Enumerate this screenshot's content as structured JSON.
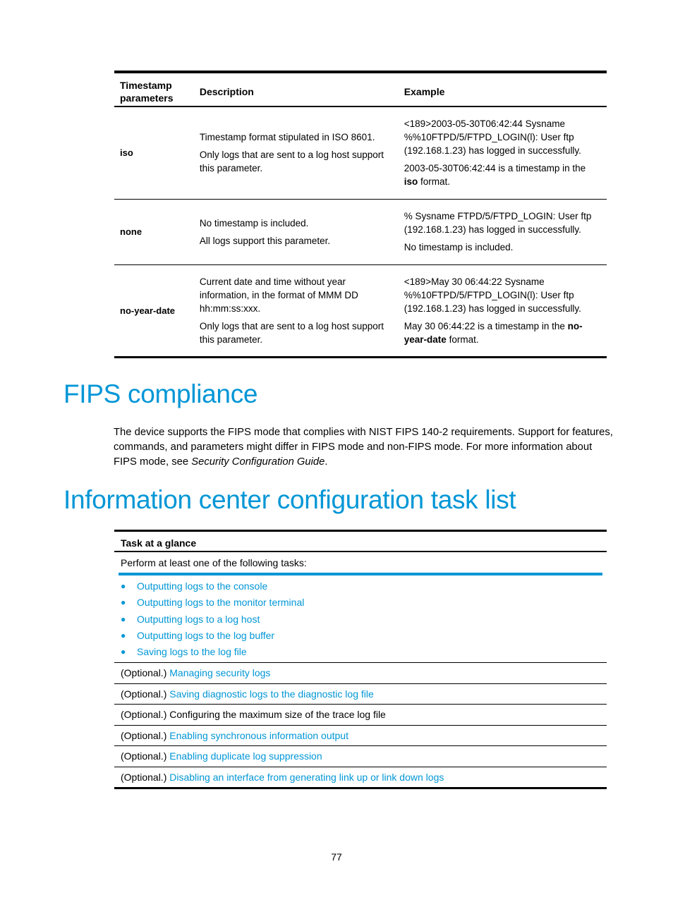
{
  "timestamp_table": {
    "headers": [
      "Timestamp parameters",
      "Description",
      "Example"
    ],
    "rows": [
      {
        "param": "iso",
        "description": [
          "Timestamp format stipulated in ISO 8601.",
          "Only logs that are sent to a log host support this parameter."
        ],
        "example_log": "<189>2003-05-30T06:42:44 Sysname %%10FTPD/5/FTPD_LOGIN(l): User ftp (192.168.1.23) has logged in successfully.",
        "example_note_pre": "2003-05-30T06:42:44 is a timestamp in the ",
        "example_note_bold": "iso",
        "example_note_post": " format."
      },
      {
        "param": "none",
        "description": [
          "No timestamp is included.",
          "All logs support this parameter."
        ],
        "example_log": "% Sysname FTPD/5/FTPD_LOGIN: User ftp (192.168.1.23) has logged in successfully.",
        "example_note_pre": "No timestamp is included.",
        "example_note_bold": "",
        "example_note_post": ""
      },
      {
        "param": "no-year-date",
        "description": [
          "Current date and time without year information, in the format of MMM DD hh:mm:ss:xxx.",
          "Only logs that are sent to a log host support this parameter."
        ],
        "example_log": "<189>May 30 06:44:22 Sysname %%10FTPD/5/FTPD_LOGIN(l): User ftp (192.168.1.23) has logged in successfully.",
        "example_note_pre": "May 30 06:44:22 is a timestamp in the ",
        "example_note_bold": "no-year-date",
        "example_note_post": " format."
      }
    ]
  },
  "fips": {
    "title": "FIPS compliance",
    "paragraph_pre": "The device supports the FIPS mode that complies with NIST FIPS 140-2 requirements. Support for features, commands, and parameters might differ in FIPS mode and non-FIPS mode. For more information about FIPS mode, see ",
    "paragraph_italic": "Security Configuration Guide",
    "paragraph_post": "."
  },
  "task_list": {
    "title": "Information center configuration task list",
    "header": "Task at a glance",
    "intro": "Perform at least one of the following tasks:",
    "bullets": [
      "Outputting logs to the console",
      "Outputting logs to the monitor terminal",
      "Outputting logs to a log host",
      "Outputting logs to the log buffer",
      "Saving logs to the log file"
    ],
    "optional_prefix": "(Optional.) ",
    "optional_rows": [
      {
        "text": "Managing security logs",
        "is_link": true
      },
      {
        "text": "Saving diagnostic logs to the diagnostic log file",
        "is_link": true
      },
      {
        "text": "Configuring the maximum size of the trace log file",
        "is_link": false
      },
      {
        "text": "Enabling synchronous information output",
        "is_link": true
      },
      {
        "text": "Enabling duplicate log suppression",
        "is_link": true
      },
      {
        "text": "Disabling an interface from generating link up or link down logs",
        "is_link": true
      }
    ]
  },
  "page_number": "77",
  "colors": {
    "accent": "#0096d6",
    "text": "#000000"
  }
}
